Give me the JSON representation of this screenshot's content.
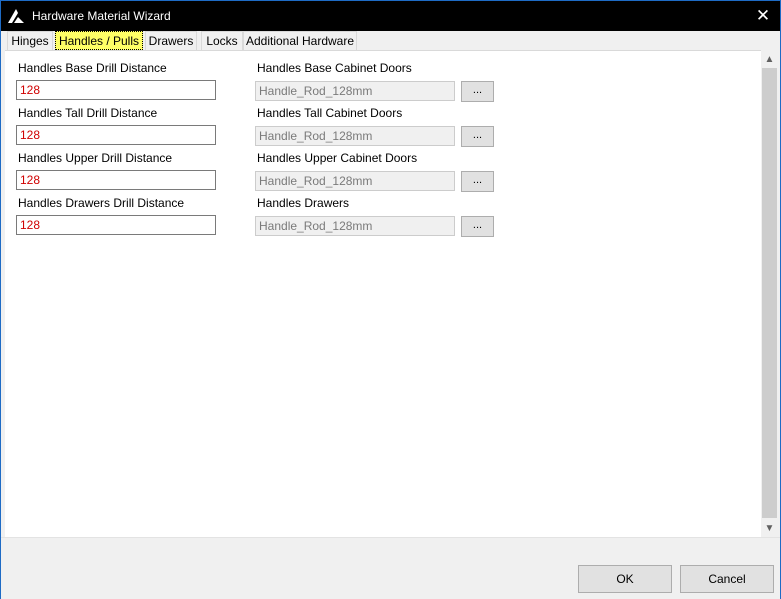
{
  "window": {
    "title": "Hardware Material Wizard",
    "close_label": "✕"
  },
  "tabs": [
    {
      "label": "Hinges"
    },
    {
      "label": "Handles / Pulls",
      "active": true
    },
    {
      "label": "Drawers"
    },
    {
      "label": "Locks"
    },
    {
      "label": "Additional Hardware"
    }
  ],
  "fields": {
    "base_drill": {
      "label": "Handles Base Drill Distance",
      "value": "128"
    },
    "tall_drill": {
      "label": "Handles Tall Drill Distance",
      "value": "128"
    },
    "upper_drill": {
      "label": "Handles Upper Drill Distance",
      "value": "128"
    },
    "drawer_drill": {
      "label": "Handles Drawers Drill Distance",
      "value": "128"
    },
    "base_doors": {
      "label": "Handles Base Cabinet Doors",
      "value": "Handle_Rod_128mm"
    },
    "tall_doors": {
      "label": "Handles Tall Cabinet Doors",
      "value": "Handle_Rod_128mm"
    },
    "upper_doors": {
      "label": "Handles Upper Cabinet Doors",
      "value": "Handle_Rod_128mm"
    },
    "drawers": {
      "label": "Handles Drawers",
      "value": "Handle_Rod_128mm"
    }
  },
  "browse_label": "...",
  "scroll": {
    "up": "▲",
    "down": "▼"
  },
  "buttons": {
    "ok": "OK",
    "cancel": "Cancel"
  },
  "colors": {
    "value_text": "#d00000",
    "active_tab": "#ffff66",
    "titlebar": "#000000"
  }
}
